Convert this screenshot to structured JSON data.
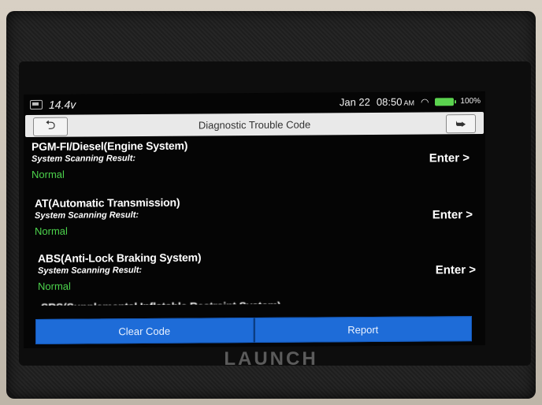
{
  "status": {
    "voltage": "14.4v",
    "date": "Jan 22",
    "time": "08:50",
    "time_suffix": "AM",
    "battery_pct": "100%",
    "battery_color": "#5bd34f"
  },
  "header": {
    "title": "Diagnostic Trouble Code",
    "back_icon": "back-arrow-icon",
    "exit_icon": "exit-icon"
  },
  "systems": [
    {
      "name": "PGM-FI/Diesel(Engine System)",
      "scan_label": "System Scanning Result:",
      "status": "Normal",
      "action": "Enter >"
    },
    {
      "name": "AT(Automatic Transmission)",
      "scan_label": "System Scanning Result:",
      "status": "Normal",
      "action": "Enter >"
    },
    {
      "name": "ABS(Anti-Lock Braking System)",
      "scan_label": "System Scanning Result:",
      "status": "Normal",
      "action": "Enter >"
    },
    {
      "name": "SRS(Supplemental Inflatable Restraint System)"
    }
  ],
  "footer": {
    "clear_code": "Clear Code",
    "report": "Report"
  },
  "device": {
    "brand": "LAUNCH"
  },
  "colors": {
    "status_normal": "#4cd24c",
    "button_blue": "#1e6cd8"
  }
}
